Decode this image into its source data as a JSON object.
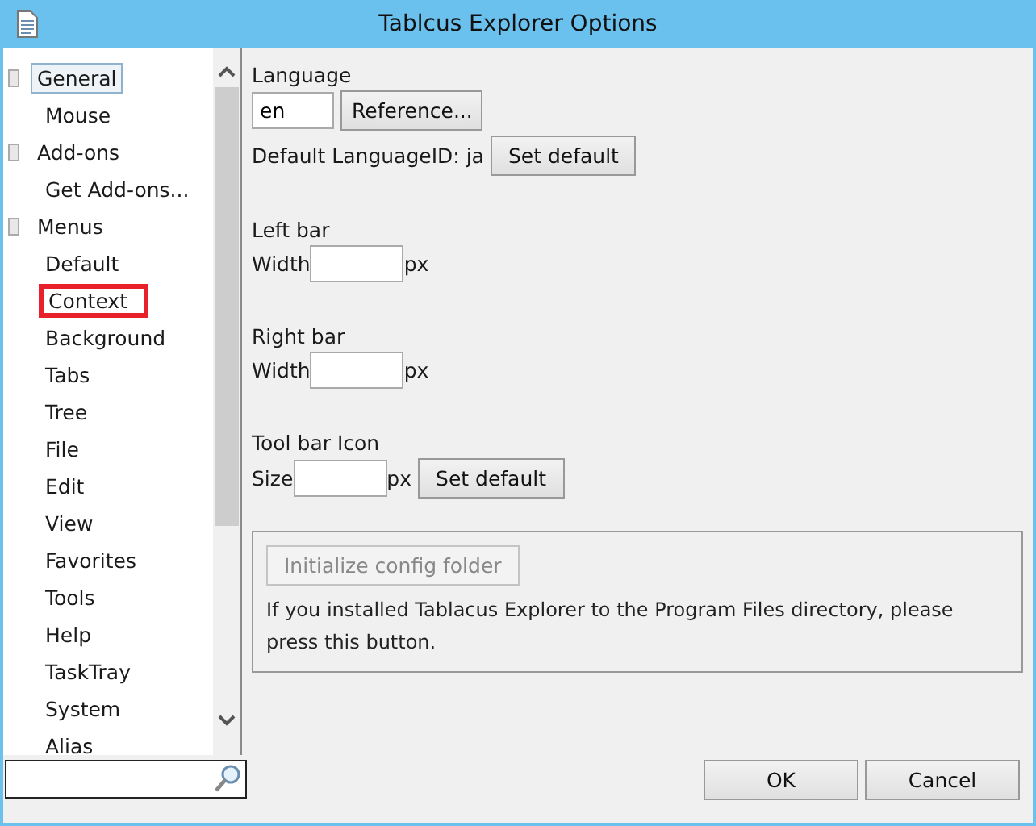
{
  "window": {
    "title": "Tablcus Explorer Options"
  },
  "tree": [
    {
      "label": "General",
      "selected": true,
      "expanded": true,
      "highlighted": false,
      "children": [
        {
          "label": "Mouse",
          "selected": false,
          "highlighted": false
        }
      ]
    },
    {
      "label": "Add-ons",
      "selected": false,
      "expanded": true,
      "highlighted": false,
      "children": [
        {
          "label": "Get Add-ons...",
          "selected": false,
          "highlighted": false
        }
      ]
    },
    {
      "label": "Menus",
      "selected": false,
      "expanded": true,
      "highlighted": false,
      "children": [
        {
          "label": "Default",
          "selected": false,
          "highlighted": false
        },
        {
          "label": "Context",
          "selected": false,
          "highlighted": true
        },
        {
          "label": "Background",
          "selected": false,
          "highlighted": false
        },
        {
          "label": "Tabs",
          "selected": false,
          "highlighted": false
        },
        {
          "label": "Tree",
          "selected": false,
          "highlighted": false
        },
        {
          "label": "File",
          "selected": false,
          "highlighted": false
        },
        {
          "label": "Edit",
          "selected": false,
          "highlighted": false
        },
        {
          "label": "View",
          "selected": false,
          "highlighted": false
        },
        {
          "label": "Favorites",
          "selected": false,
          "highlighted": false
        },
        {
          "label": "Tools",
          "selected": false,
          "highlighted": false
        },
        {
          "label": "Help",
          "selected": false,
          "highlighted": false
        },
        {
          "label": "TaskTray",
          "selected": false,
          "highlighted": false
        },
        {
          "label": "System",
          "selected": false,
          "highlighted": false
        },
        {
          "label": "Alias",
          "selected": false,
          "highlighted": false
        }
      ]
    }
  ],
  "language": {
    "label": "Language",
    "value": "en",
    "reference_button": "Reference...",
    "default_text": "Default LanguageID: ja",
    "set_default_button": "Set default"
  },
  "left_bar": {
    "label": "Left bar",
    "field_label": "Width",
    "unit": "px"
  },
  "right_bar": {
    "label": "Right bar",
    "field_label": "Width",
    "unit": "px"
  },
  "toolbar_icon": {
    "label": "Tool bar Icon",
    "field_label": "Size",
    "unit": "px",
    "set_default_button": "Set default"
  },
  "config": {
    "button": "Initialize config folder",
    "disabled": true,
    "note": "If you installed Tablacus Explorer to the Program Files directory, please press this button."
  },
  "buttons": [
    "OK",
    "Cancel"
  ]
}
